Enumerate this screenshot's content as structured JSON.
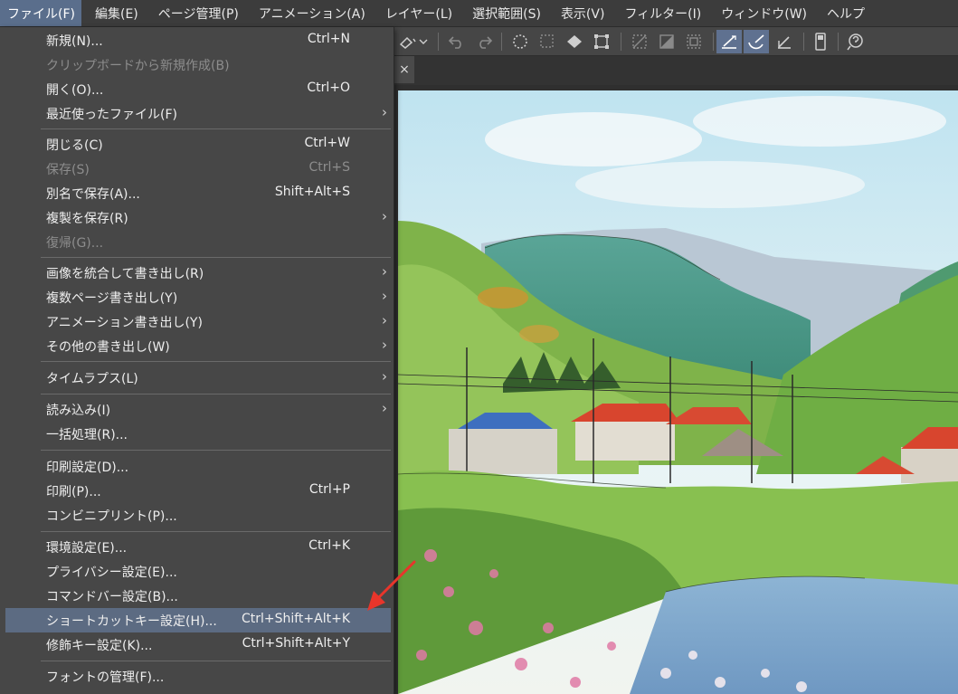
{
  "menubar": {
    "items": [
      {
        "label": "ファイル(F)"
      },
      {
        "label": "編集(E)"
      },
      {
        "label": "ページ管理(P)"
      },
      {
        "label": "アニメーション(A)"
      },
      {
        "label": "レイヤー(L)"
      },
      {
        "label": "選択範囲(S)"
      },
      {
        "label": "表示(V)"
      },
      {
        "label": "フィルター(I)"
      },
      {
        "label": "ウィンドウ(W)"
      },
      {
        "label": "ヘルプ"
      }
    ]
  },
  "file_menu": {
    "items": [
      {
        "label": "新規(N)...",
        "shortcut": "Ctrl+N"
      },
      {
        "label": "クリップボードから新規作成(B)",
        "shortcut": ""
      },
      {
        "label": "開く(O)...",
        "shortcut": "Ctrl+O"
      },
      {
        "label": "最近使ったファイル(F)",
        "shortcut": ""
      },
      {
        "label": "閉じる(C)",
        "shortcut": "Ctrl+W"
      },
      {
        "label": "保存(S)",
        "shortcut": "Ctrl+S"
      },
      {
        "label": "別名で保存(A)...",
        "shortcut": "Shift+Alt+S"
      },
      {
        "label": "複製を保存(R)",
        "shortcut": ""
      },
      {
        "label": "復帰(G)...",
        "shortcut": ""
      },
      {
        "label": "画像を統合して書き出し(R)",
        "shortcut": ""
      },
      {
        "label": "複数ページ書き出し(Y)",
        "shortcut": ""
      },
      {
        "label": "アニメーション書き出し(Y)",
        "shortcut": ""
      },
      {
        "label": "その他の書き出し(W)",
        "shortcut": ""
      },
      {
        "label": "タイムラプス(L)",
        "shortcut": ""
      },
      {
        "label": "読み込み(I)",
        "shortcut": ""
      },
      {
        "label": "一括処理(R)...",
        "shortcut": ""
      },
      {
        "label": "印刷設定(D)...",
        "shortcut": ""
      },
      {
        "label": "印刷(P)...",
        "shortcut": "Ctrl+P"
      },
      {
        "label": "コンビニプリント(P)...",
        "shortcut": ""
      },
      {
        "label": "環境設定(E)...",
        "shortcut": "Ctrl+K"
      },
      {
        "label": "プライバシー設定(E)...",
        "shortcut": ""
      },
      {
        "label": "コマンドバー設定(B)...",
        "shortcut": ""
      },
      {
        "label": "ショートカットキー設定(H)...",
        "shortcut": "Ctrl+Shift+Alt+K"
      },
      {
        "label": "修飾キー設定(K)...",
        "shortcut": "Ctrl+Shift+Alt+Y"
      },
      {
        "label": "フォントの管理(F)...",
        "shortcut": ""
      }
    ],
    "submenu_glyph": "›"
  },
  "tab": {
    "close_glyph": "×"
  },
  "colors": {
    "menu_bg": "#474747",
    "highlight": "#5c6b82",
    "menubar_active": "#5a6e8c",
    "disabled_text": "#8d8d8d",
    "arrow": "#e8352b"
  },
  "icons": {
    "toolbar": [
      "fill-icon",
      "undo-icon",
      "redo-icon",
      "lasso-icon",
      "select-icon",
      "bucket-icon",
      "transform-icon",
      "clear-icon",
      "invert-icon",
      "frame-icon",
      "ruler-icon",
      "brush-ruler-icon",
      "snap-icon",
      "device-icon",
      "help-icon"
    ]
  }
}
